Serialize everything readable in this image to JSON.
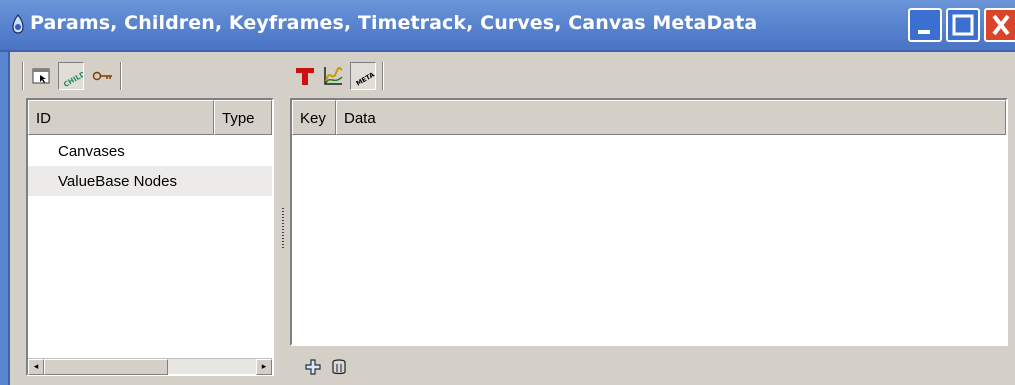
{
  "window": {
    "title": "Params, Children, Keyframes, Timetrack, Curves, Canvas MetaData",
    "title_color": "#5a85cf",
    "controls": [
      "minimize-icon",
      "maximize-icon",
      "close-icon"
    ]
  },
  "left_panel": {
    "tabs": [
      {
        "name": "params",
        "icon": "params-icon",
        "active": false
      },
      {
        "name": "children",
        "icon": "child-icon",
        "active": true
      },
      {
        "name": "keyframes",
        "icon": "key-icon",
        "active": false
      }
    ],
    "columns": [
      "ID",
      "Type"
    ],
    "rows": [
      {
        "id": "Canvases",
        "type": ""
      },
      {
        "id": "ValueBase Nodes",
        "type": ""
      }
    ]
  },
  "right_panel": {
    "tabs": [
      {
        "name": "timetrack",
        "icon": "timetrack-icon",
        "active": false
      },
      {
        "name": "curves",
        "icon": "curves-icon",
        "active": false
      },
      {
        "name": "canvas-metadata",
        "icon": "meta-icon",
        "active": true
      }
    ],
    "columns": [
      "Key",
      "Data"
    ],
    "actions": [
      {
        "name": "add",
        "icon": "add-icon"
      },
      {
        "name": "delete",
        "icon": "trash-icon"
      }
    ]
  },
  "labels": {
    "child_icon_text": "CHILD",
    "meta_icon_text": "META"
  }
}
